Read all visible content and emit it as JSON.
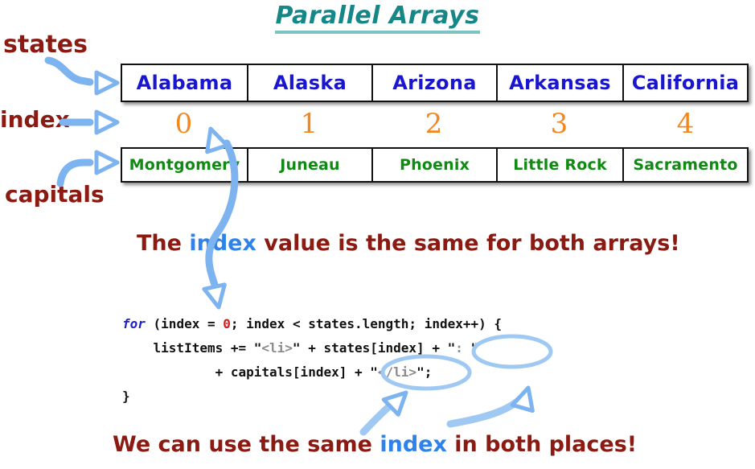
{
  "title": {
    "text": "Parallel Arrays",
    "color": "#158787"
  },
  "labels": {
    "states": "states",
    "index": "index",
    "capitals": "capitals",
    "color": "#8b1a12"
  },
  "arrays": {
    "states": {
      "name": "states",
      "color": "#1a16cf",
      "cells": [
        "Alabama",
        "Alaska",
        "Arizona",
        "Arkansas",
        "California"
      ]
    },
    "index": {
      "name": "index",
      "color": "#f2871f",
      "cells": [
        "0",
        "1",
        "2",
        "3",
        "4"
      ]
    },
    "capitals": {
      "name": "capitals",
      "color": "#0f8a12",
      "cells": [
        "Montgomery",
        "Juneau",
        "Phoenix",
        "Little Rock",
        "Sacramento"
      ]
    }
  },
  "captions": {
    "top": {
      "before": "The ",
      "highlight": "index",
      "after": " value is the same for both arrays!"
    },
    "bottom": {
      "before": "We can use the same ",
      "highlight": "index",
      "after": " in both places!"
    },
    "highlight_color": "#2f83e8",
    "color": "#8b1a12"
  },
  "code": {
    "line1": {
      "kw": "for",
      "p1": " (index = ",
      "num": "0",
      "p2": "; index < states.length; index++) {"
    },
    "line2": {
      "p1": "    listItems += \"",
      "tag": "<li>",
      "p2": "\" + states[index] + \"",
      "tag2": ": ",
      "p3": "\""
    },
    "line3": {
      "p1": "            + capitals[index] + \"",
      "tag": "</li>",
      "p2": "\";"
    },
    "line4": {
      "p1": "}"
    }
  },
  "annotations": {
    "arrow_color": "#7db4ef",
    "arrows": [
      {
        "name": "states-label-to-array",
        "desc": "curved arrow from states label into states array"
      },
      {
        "name": "index-label-to-row",
        "desc": "straight arrow from index label to index number row"
      },
      {
        "name": "capitals-label-to-array",
        "desc": "curved arrow from capitals label into capitals array"
      },
      {
        "name": "loop-init-to-index-zero",
        "desc": "long S curve from for-loop initializer up to index 0"
      },
      {
        "name": "caption-to-capitals-index",
        "desc": "arrow from bottom caption to capitals[index]"
      },
      {
        "name": "caption-to-closing-tag",
        "desc": "arrow from bottom caption to closing li tag"
      }
    ],
    "ellipses": [
      {
        "name": "states-index-ellipse",
        "desc": "ellipse around states[index] subscript"
      },
      {
        "name": "capitals-index-ellipse",
        "desc": "ellipse around capitals[index] subscript"
      }
    ]
  }
}
